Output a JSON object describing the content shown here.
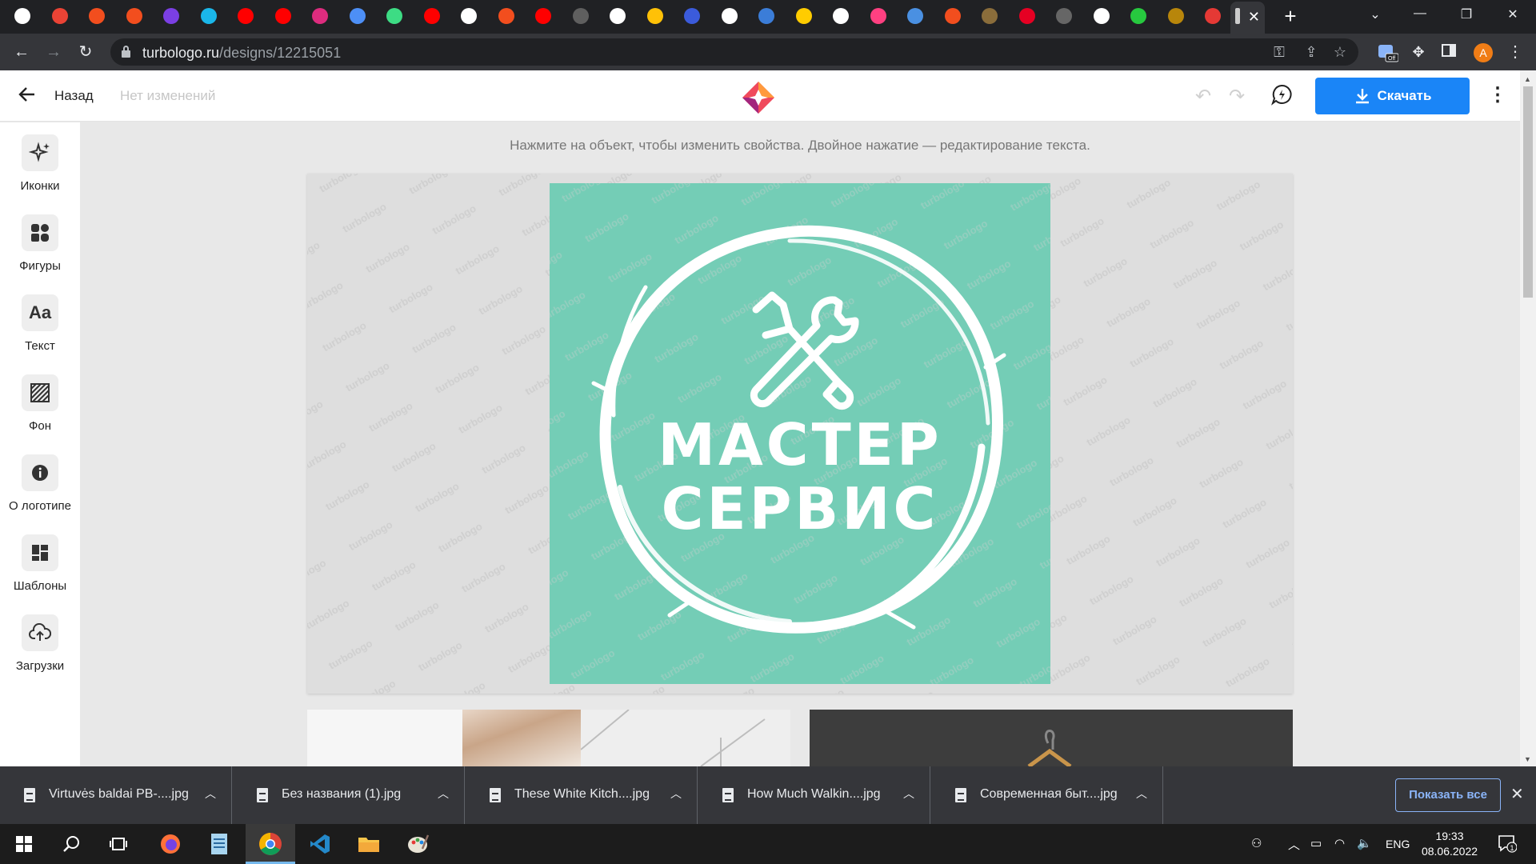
{
  "browser": {
    "url_host": "turbologo.ru",
    "url_path": "/designs/12215051",
    "profile_initial": "А",
    "favicon_colors": [
      "#ffffff",
      "#ea4335",
      "#f24e1e",
      "#f24e1e",
      "#7b3fe4",
      "#1ab7ea",
      "#ff0000",
      "#ff0000",
      "#dd2c7e",
      "#4d8ff6",
      "#3ddc84",
      "#ff0000",
      "#ffffff",
      "#f24e1e",
      "#ff0000",
      "#5f5f5f",
      "#ffffff",
      "#ffc107",
      "#3b5bdb",
      "#ffffff",
      "#3b7dd8",
      "#ffcc00",
      "#ffffff",
      "#ff4081",
      "#4a90e2",
      "#f24e1e",
      "#8a6d3b",
      "#e60023",
      "#666666",
      "#ffffff",
      "#27c93f",
      "#b8860b",
      "#e53935"
    ]
  },
  "app": {
    "back_label": "Назад",
    "status": "Нет изменений",
    "download_label": "Скачать",
    "hint": "Нажмите на объект, чтобы изменить свойства. Двойное нажатие — редактирование текста.",
    "accent_color": "#1a85f7"
  },
  "sidebar": {
    "items": [
      {
        "label": "Иконки",
        "icon": "sparkles-icon"
      },
      {
        "label": "Фигуры",
        "icon": "shapes-icon"
      },
      {
        "label": "Текст",
        "icon": "text-aa-icon"
      },
      {
        "label": "Фон",
        "icon": "background-stripes-icon"
      },
      {
        "label": "О логотипе",
        "icon": "info-icon"
      },
      {
        "label": "Шаблоны",
        "icon": "templates-grid-icon"
      },
      {
        "label": "Загрузки",
        "icon": "cloud-upload-icon"
      }
    ]
  },
  "design": {
    "background_color": "#74cdb6",
    "line1": "МАСТЕР",
    "line2": "СЕРВИС",
    "icon": "wrench-screwdriver-icon",
    "watermark_text": "turbologo"
  },
  "downloads": {
    "items": [
      {
        "name": "Virtuvės baldai PB-....jpg"
      },
      {
        "name": "Без названия (1).jpg"
      },
      {
        "name": "These White Kitch....jpg"
      },
      {
        "name": "How Much Walkin....jpg"
      },
      {
        "name": "Современная быт....jpg"
      }
    ],
    "show_all_label": "Показать все"
  },
  "taskbar": {
    "lang": "ENG",
    "time": "19:33",
    "date": "08.06.2022",
    "notification_count": "1"
  }
}
